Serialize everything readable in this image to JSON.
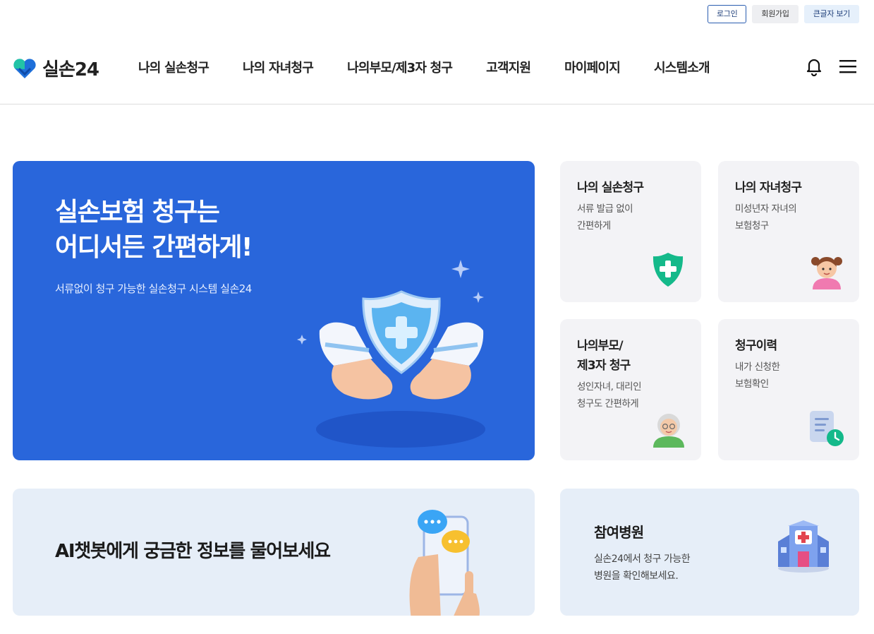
{
  "utility": {
    "login": "로그인",
    "join": "회원가입",
    "large_text": "큰글자 보기"
  },
  "header": {
    "logo_text": "실손24",
    "nav": [
      "나의 실손청구",
      "나의 자녀청구",
      "나의부모/제3자 청구",
      "고객지원",
      "마이페이지",
      "시스템소개"
    ],
    "icons": [
      "bell-icon",
      "menu-icon"
    ]
  },
  "hero": {
    "title_line1": "실손보험 청구는",
    "title_line2": "어디서든 간편하게!",
    "subtitle": "서류없이 청구 가능한 실손청구 시스템 실손24"
  },
  "cards": [
    {
      "title": "나의 실손청구",
      "desc1": "서류 발급 없이",
      "desc2": "간편하게",
      "icon": "shield-plus-icon"
    },
    {
      "title": "나의 자녀청구",
      "desc1": "미성년자 자녀의",
      "desc2": "보험청구",
      "icon": "child-icon"
    },
    {
      "title1": "나의부모/",
      "title2": "제3자 청구",
      "desc1": "성인자녀, 대리인",
      "desc2": "청구도 간편하게",
      "icon": "grandparent-icon"
    },
    {
      "title": "청구이력",
      "desc1": "내가 신청한",
      "desc2": "보험확인",
      "icon": "document-clock-icon"
    }
  ],
  "chatbot": {
    "text": "AI챗봇에게 궁금한 정보를 물어보세요"
  },
  "hospital": {
    "title": "참여병원",
    "desc1": "실손24에서 청구 가능한",
    "desc2": "병원을 확인해보세요."
  },
  "colors": {
    "hero_bg": "#2966db",
    "card_bg": "#f3f3f6",
    "banner_bg": "#e6eef8",
    "accent_green": "#14b98a"
  }
}
